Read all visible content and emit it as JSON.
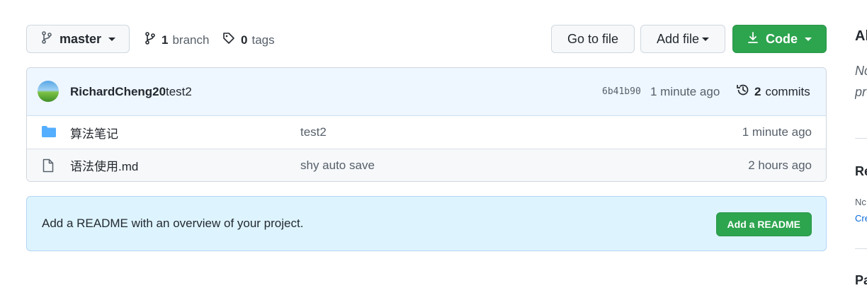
{
  "toolbar": {
    "branch_name": "master",
    "branch_count": "1",
    "branch_label": "branch",
    "tag_count": "0",
    "tag_label": "tags",
    "goto_label": "Go to file",
    "addfile_label": "Add file",
    "code_label": "Code"
  },
  "commit": {
    "author": "RichardCheng20",
    "message": "test2",
    "sha": "6b41b90",
    "time": "1 minute ago",
    "commit_count": "2",
    "commit_label": "commits"
  },
  "files": [
    {
      "type": "folder",
      "name": "算法笔记",
      "message": "test2",
      "time": "1 minute ago"
    },
    {
      "type": "file",
      "name": "语法使用.md",
      "message": "shy auto save",
      "time": "2 hours ago"
    }
  ],
  "readme": {
    "text": "Add a README with an overview of your project.",
    "button": "Add a README"
  },
  "sidebar": {
    "about_heading": "Al",
    "desc_line1": "Nc",
    "desc_line2": "pr",
    "releases_heading": "Re",
    "releases_text": "Nc",
    "releases_link": "Cre",
    "packages_heading": "Pa"
  },
  "colors": {
    "accent_green": "#2da44e",
    "folder_blue": "#54aeff",
    "link_blue": "#0969da"
  }
}
